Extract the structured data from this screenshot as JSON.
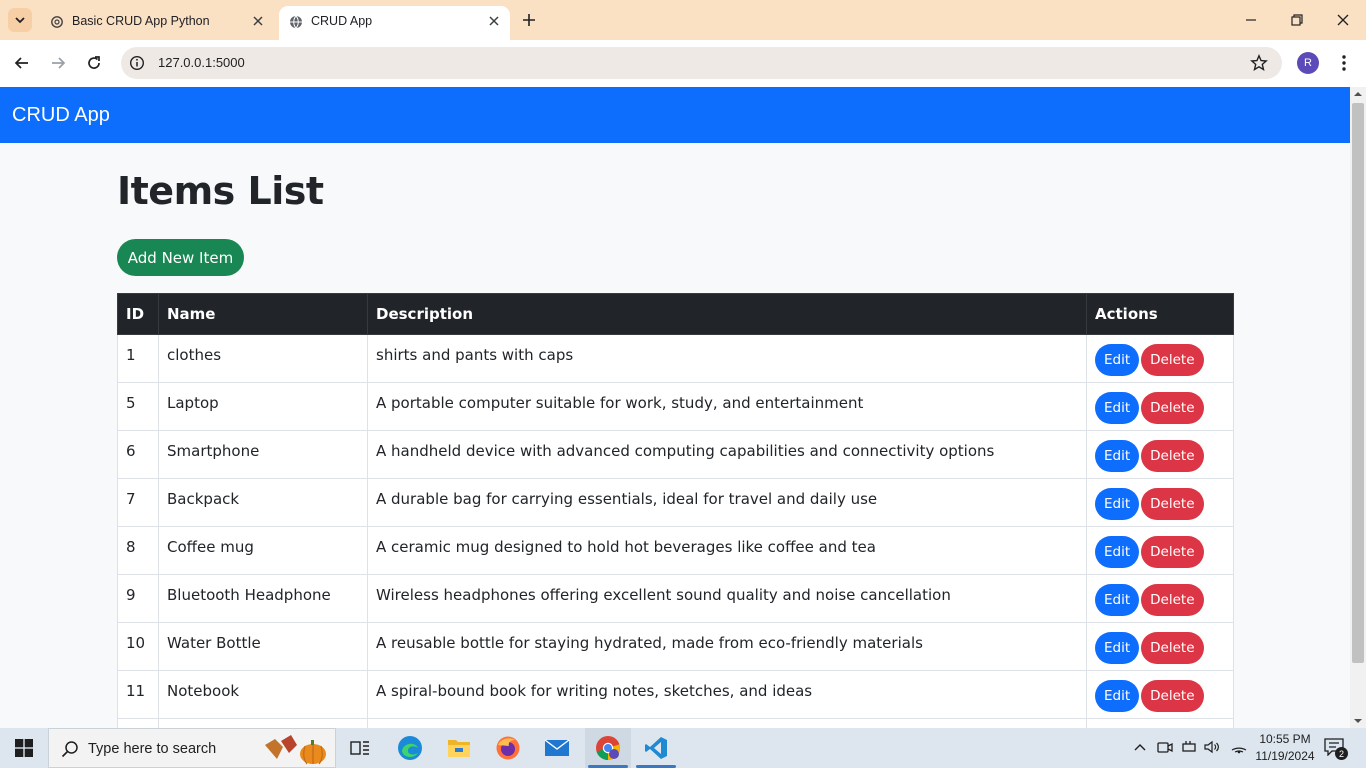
{
  "browser": {
    "tabs": [
      {
        "title": "Basic CRUD App Python",
        "icon": "openai-icon"
      },
      {
        "title": "CRUD App",
        "icon": "globe-icon",
        "active": true
      }
    ],
    "url": "127.0.0.1:5000",
    "profile_initial": "R"
  },
  "page": {
    "brand": "CRUD App",
    "heading": "Items List",
    "add_button": "Add New Item",
    "colors": {
      "navbar": "#0d6efd",
      "add": "#198754",
      "edit": "#0d6efd",
      "delete": "#dc3545",
      "header": "#212529"
    }
  },
  "table": {
    "headers": [
      "ID",
      "Name",
      "Description",
      "Actions"
    ],
    "edit_label": "Edit",
    "delete_label": "Delete",
    "rows": [
      {
        "id": "1",
        "name": "clothes",
        "description": "shirts and pants with caps"
      },
      {
        "id": "5",
        "name": "Laptop",
        "description": "A portable computer suitable for work, study, and entertainment"
      },
      {
        "id": "6",
        "name": "Smartphone",
        "description": "A handheld device with advanced computing capabilities and connectivity options"
      },
      {
        "id": "7",
        "name": "Backpack",
        "description": "A durable bag for carrying essentials, ideal for travel and daily use"
      },
      {
        "id": "8",
        "name": "Coffee mug",
        "description": "A ceramic mug designed to hold hot beverages like coffee and tea"
      },
      {
        "id": "9",
        "name": "Bluetooth Headphone",
        "description": "Wireless headphones offering excellent sound quality and noise cancellation"
      },
      {
        "id": "10",
        "name": "Water Bottle",
        "description": "A reusable bottle for staying hydrated, made from eco-friendly materials"
      },
      {
        "id": "11",
        "name": "Notebook",
        "description": "A spiral-bound book for writing notes, sketches, and ideas"
      },
      {
        "id": "",
        "name": "",
        "description": ""
      }
    ]
  },
  "taskbar": {
    "search_placeholder": "Type here to search",
    "time": "10:55 PM",
    "date": "11/19/2024",
    "notification_count": "2",
    "apps": [
      "task-view-icon",
      "edge-icon",
      "file-explorer-icon",
      "firefox-icon",
      "mail-icon",
      "chrome-icon",
      "vscode-icon"
    ]
  }
}
